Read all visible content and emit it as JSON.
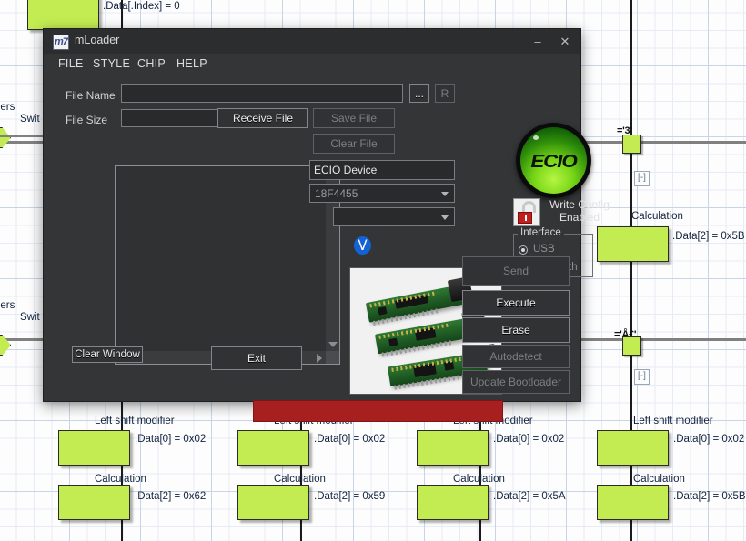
{
  "flowchart": {
    "nodes": [
      {
        "label": "",
        "value": ".Data[.Index] = 0"
      },
      {
        "label": "Calculation",
        "value": ".Data[2] = 0x5B"
      },
      {
        "label": "Left shift modifier",
        "value": ".Data[0] = 0x02"
      },
      {
        "label": "Calculation",
        "value": ".Data[2] = 0x62"
      },
      {
        "label": "Left shift modifier",
        "value": ".Data[0] = 0x02"
      },
      {
        "label": "Calculation",
        "value": ".Data[2] = 0x59"
      },
      {
        "label": "Left shift modifier",
        "value": ".Data[0] = 0x02"
      },
      {
        "label": "Calculation",
        "value": ".Data[2] = 0x5A"
      },
      {
        "label": "Left shift modifier",
        "value": ".Data[0] = 0x02"
      },
      {
        "label": "Calculation",
        "value": ".Data[2] = 0x5B"
      }
    ],
    "branch_labels": [
      {
        "text": "='3'"
      },
      {
        "text": "='Å£'"
      }
    ],
    "collapse_marker": "[-]",
    "edge_text": [
      {
        "text": "bers"
      },
      {
        "text": "Swit"
      }
    ],
    "colors": {
      "node_fill": "#c3ec52",
      "node_border": "#2b2b2b",
      "grid_major": "#c9d4e8",
      "grid_minor": "#e6ecf6",
      "swimlane": "#808080"
    }
  },
  "window": {
    "title": "mLoader",
    "logo_glyph": "m7",
    "controls": {
      "minimize": "–",
      "close": "✕"
    },
    "menu": [
      "FILE",
      "STYLE",
      "CHIP",
      "HELP"
    ],
    "fields": {
      "file_name_label": "File Name",
      "file_name_value": "",
      "file_name_placeholder": "",
      "file_size_label": "File Size",
      "file_size_value": "",
      "file_size_placeholder": "",
      "browse_button": "...",
      "refresh_button": "R"
    },
    "buttons": {
      "receive_file": "Receive File",
      "save_file": "Save File",
      "clear_file": "Clear File",
      "clear_window": "Clear Window",
      "exit": "Exit",
      "send": "Send",
      "execute": "Execute",
      "erase": "Erase",
      "autodetect": "Autodetect",
      "update_bootloader": "Update Bootloader"
    },
    "device": {
      "name_value": "ECIO Device",
      "chip_value": "18F4455",
      "bluetooth_value": "",
      "bluetooth_icon": "bluetooth-icon"
    },
    "write_config": {
      "line1": "Write Config",
      "line2": "Enabled",
      "icon": "unlocked-padlock-icon"
    },
    "interface": {
      "legend": "Interface",
      "options": [
        "USB",
        "Bluetooth"
      ],
      "selected": "USB"
    },
    "log": {
      "value": ""
    },
    "brand": {
      "logo_text": "ECIO"
    },
    "progress": {
      "value": "",
      "color": "#a81f1f"
    }
  }
}
